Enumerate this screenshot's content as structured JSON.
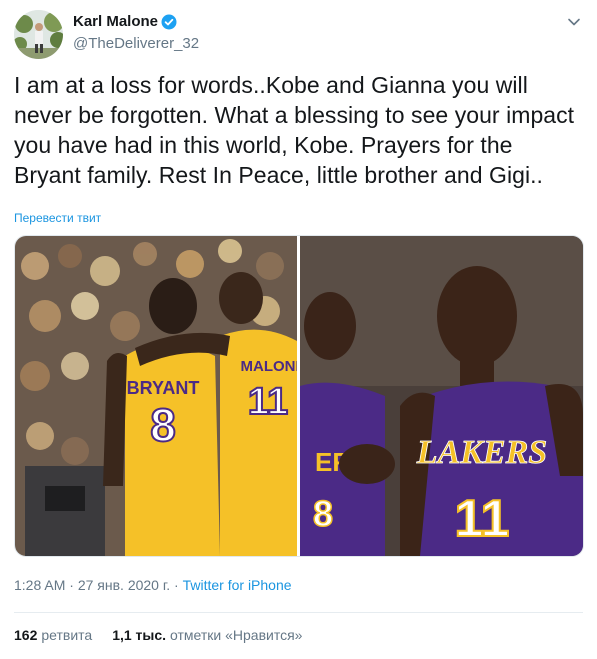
{
  "author": {
    "display_name": "Karl Malone",
    "handle": "@TheDeliverer_32",
    "verified": true
  },
  "tweet": {
    "text": "I am at a loss for words..Kobe and Gianna you will never be forgotten. What a blessing to see your impact you have had in this world, Kobe. Prayers for the Bryant family. Rest In Peace, little brother and Gigi..",
    "translate_label": "Перевести твит"
  },
  "media": {
    "left": {
      "jersey_name_1": "BRYANT",
      "jersey_number_1": "8",
      "jersey_name_2": "MALONE",
      "jersey_number_2": "11"
    },
    "right": {
      "jersey_team": "LAKERS",
      "jersey_number_big": "11",
      "jersey_number_small": "8"
    }
  },
  "meta": {
    "time": "1:28 AM",
    "separator": " · ",
    "date": "27 янв. 2020 г.",
    "source": "Twitter for iPhone"
  },
  "stats": {
    "retweets_count": "162",
    "retweets_label": "ретвита",
    "likes_count": "1,1 тыс.",
    "likes_label": "отметки «Нравится»"
  },
  "colors": {
    "link": "#1b95e0",
    "muted": "#657786",
    "lakers_gold": "#f5c128",
    "lakers_purple": "#4b2a86"
  }
}
